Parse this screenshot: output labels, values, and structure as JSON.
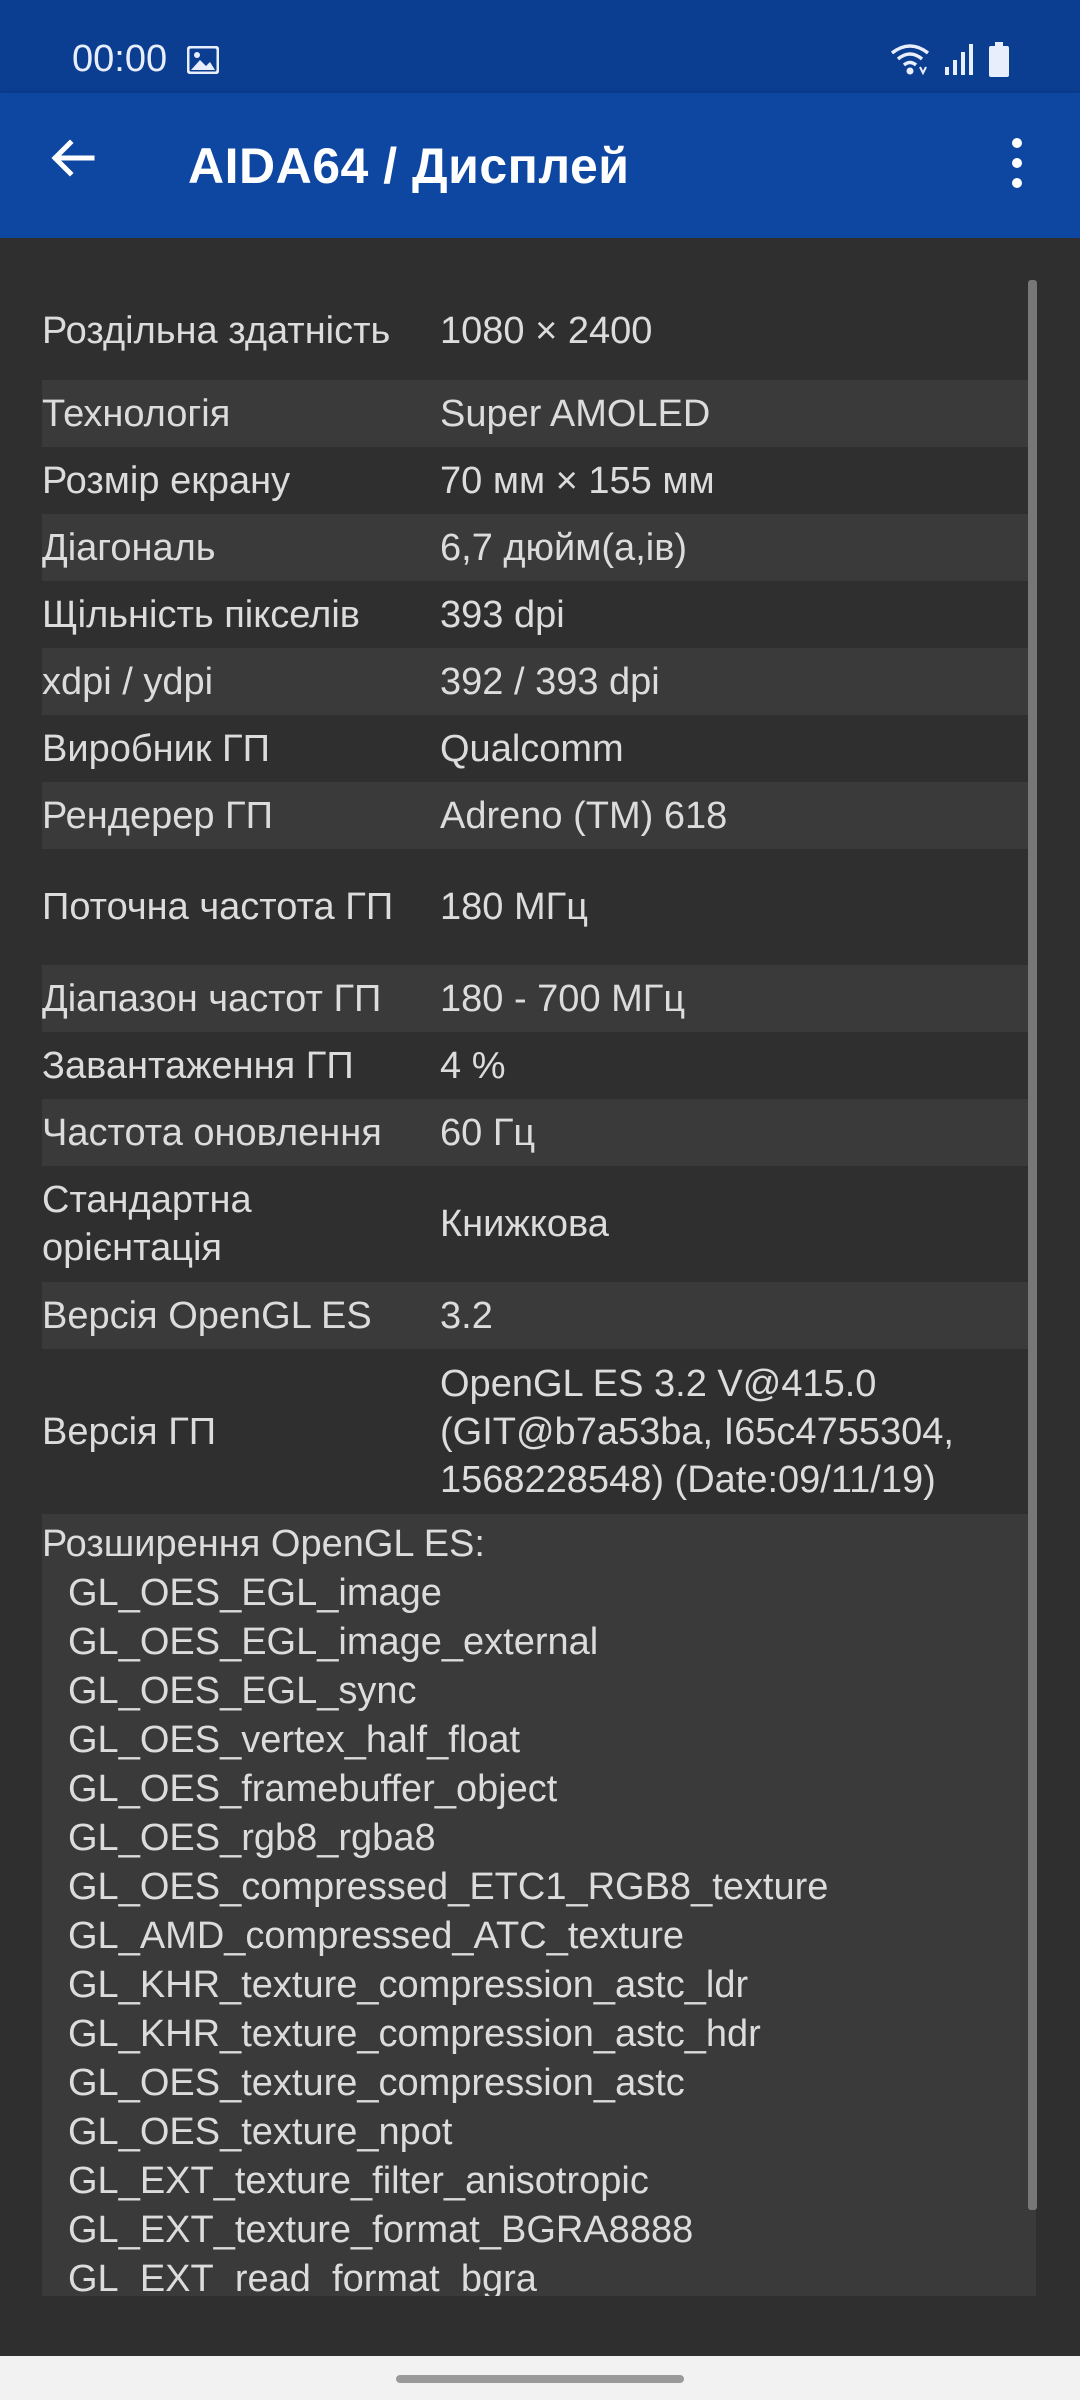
{
  "status_bar": {
    "time": "00:00",
    "icons": [
      "image-icon",
      "wifi-icon",
      "signal-icon",
      "battery-icon"
    ]
  },
  "app_bar": {
    "title": "AIDA64  /  Дисплей",
    "back_icon": "arrow-left-icon",
    "menu_icon": "more-vert-icon"
  },
  "colors": {
    "status_bar": "#0b3d91",
    "app_bar": "#0d47a1",
    "background": "#2f2f2f",
    "row_alt": "#3a3a3a",
    "text": "#dcdcdc"
  },
  "rows": [
    {
      "label": "Роздільна здатність",
      "value": "1080 × 2400"
    },
    {
      "label": "Технологія",
      "value": "Super AMOLED"
    },
    {
      "label": "Розмір екрану",
      "value": "70 мм × 155 мм"
    },
    {
      "label": "Діагональ",
      "value": "6,7 дюйм(а,ів)"
    },
    {
      "label": "Щільність пікселів",
      "value": "393 dpi"
    },
    {
      "label": "xdpi / ydpi",
      "value": "392 / 393 dpi"
    },
    {
      "label": "Виробник ГП",
      "value": "Qualcomm"
    },
    {
      "label": "Рендерер ГП",
      "value": "Adreno (TM) 618"
    },
    {
      "label": "Поточна частота ГП",
      "value": "180 МГц"
    },
    {
      "label": "Діапазон частот ГП",
      "value": "180 - 700 МГц"
    },
    {
      "label": "Завантаження ГП",
      "value": "4 %"
    },
    {
      "label": "Частота оновлення",
      "value": "60 Гц"
    },
    {
      "label": "Стандартна орієнтація",
      "value": "Книжкова"
    },
    {
      "label": "Версія OpenGL ES",
      "value": "3.2"
    },
    {
      "label": "Версія ГП",
      "value": "OpenGL ES 3.2 V@415.0 (GIT@b7a53ba, I65c4755304, 1568228548) (Date:09/11/19)"
    }
  ],
  "extensions": {
    "title": "Розширення OpenGL ES:",
    "items": [
      "GL_OES_EGL_image",
      "GL_OES_EGL_image_external",
      "GL_OES_EGL_sync",
      "GL_OES_vertex_half_float",
      "GL_OES_framebuffer_object",
      "GL_OES_rgb8_rgba8",
      "GL_OES_compressed_ETC1_RGB8_texture",
      "GL_AMD_compressed_ATC_texture",
      "GL_KHR_texture_compression_astc_ldr",
      "GL_KHR_texture_compression_astc_hdr",
      "GL_OES_texture_compression_astc",
      "GL_OES_texture_npot",
      "GL_EXT_texture_filter_anisotropic",
      "GL_EXT_texture_format_BGRA8888",
      "GL_EXT_read_format_bgra"
    ]
  }
}
